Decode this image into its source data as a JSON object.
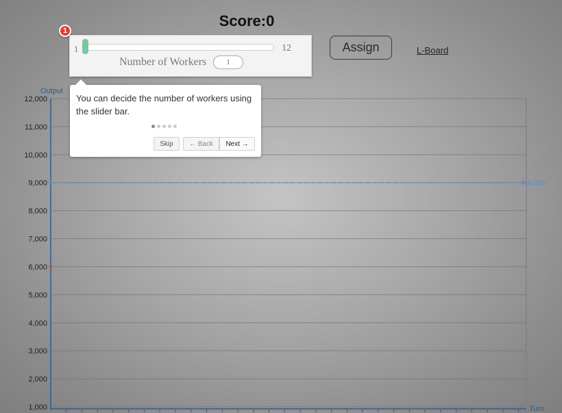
{
  "score": {
    "label": "Score:0"
  },
  "controls": {
    "assign_label": "Assign",
    "lboard_label": "L-Board"
  },
  "slider": {
    "min_label": "1",
    "max_label": "12",
    "min": 1,
    "max": 12,
    "value": 1,
    "workers_label": "Number of Workers",
    "workers_value": "1"
  },
  "tour": {
    "step_number": "1",
    "text": "You can decide the number of workers using the slider bar.",
    "total_steps": 5,
    "current_step": 1,
    "skip_label": "Skip",
    "back_label": "← Back",
    "next_label": "Next →"
  },
  "colors": {
    "accent_line": "#5b8ec2",
    "marker": "#c0562a",
    "slider_handle": "#7cc4a0",
    "step_marker": "#e23c35"
  },
  "chart_data": {
    "type": "line",
    "ylabel": "Output",
    "xlabel": "Turn",
    "ylim": [
      1000,
      12000
    ],
    "yticks": [
      1000,
      2000,
      3000,
      4000,
      5000,
      6000,
      7000,
      8000,
      9000,
      10000,
      11000,
      12000
    ],
    "ytick_labels": [
      "1,000",
      "2,000",
      "3,000",
      "4,000",
      "5,000",
      "6,000",
      "7,000",
      "8,000",
      "9,000",
      "10,000",
      "11,000",
      "12,000"
    ],
    "x_tick_count": 30,
    "grid": true,
    "reference_line": {
      "value": 9000,
      "label": "9,000",
      "style": "dashed"
    },
    "points": [
      {
        "x": 0,
        "y": 6000
      }
    ]
  }
}
